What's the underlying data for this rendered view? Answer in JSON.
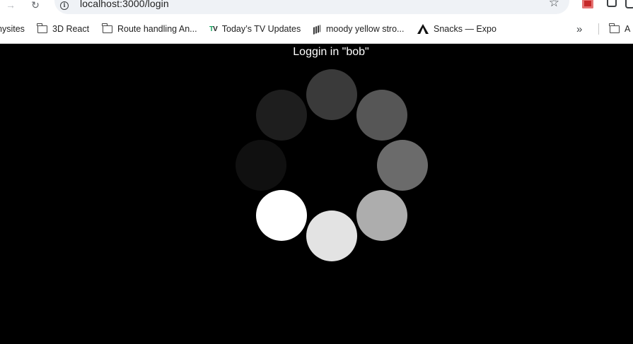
{
  "browser": {
    "url": "localhost:3000/login",
    "bookmarks": [
      {
        "label": "nysites",
        "icon": "none"
      },
      {
        "label": "3D React",
        "icon": "folder-icon"
      },
      {
        "label": "Route handling An...",
        "icon": "folder-icon"
      },
      {
        "label": "Today’s TV Updates",
        "icon": "tv-logo-icon"
      },
      {
        "label": "moody yellow stro...",
        "icon": "cube-logo-icon"
      },
      {
        "label": "Snacks — Expo",
        "icon": "expo-logo-icon"
      },
      {
        "label": "A",
        "icon": "folder-icon"
      }
    ],
    "overflow_label": "»"
  },
  "page": {
    "status_text": "Loggin in \"bob\"",
    "spinner": {
      "dot_shades": [
        "#3a3a3a",
        "#565656",
        "#6b6b6b",
        "#adadad",
        "#e3e3e3",
        "#ffffff",
        "#101010",
        "#1e1e1e"
      ]
    }
  }
}
